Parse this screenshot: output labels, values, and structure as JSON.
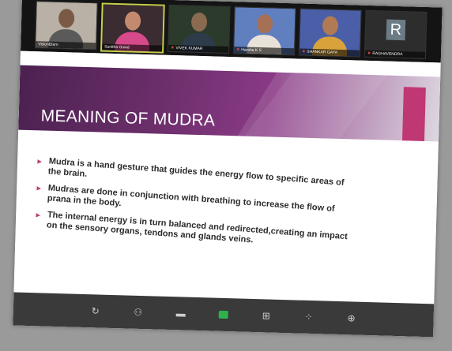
{
  "participants": [
    {
      "name": "VisionEtern",
      "type": "video",
      "skin": "#7a5a45",
      "shirt": "#5a5a5a",
      "bg": "#b9b0a6"
    },
    {
      "name": "Sunitha Gowd",
      "type": "video",
      "skin": "#c48a6f",
      "shirt": "#d6498a",
      "bg": "#3a2c30",
      "speaking": true
    },
    {
      "name": "VIVEK KUMAR",
      "type": "video",
      "skin": "#8a6a50",
      "shirt": "#2e3b4a",
      "bg": "#2b3a2a",
      "muted": true
    },
    {
      "name": "Harsha K S",
      "type": "video",
      "skin": "#a57055",
      "shirt": "#e8e2d8",
      "bg": "#5f7fbf",
      "muted": true
    },
    {
      "name": "SHANKAR GAYA",
      "type": "video",
      "skin": "#b07a55",
      "shirt": "#d9a23b",
      "bg": "#4a5fa8",
      "muted": true
    },
    {
      "name": "RAGHAVENDRA",
      "type": "avatar",
      "initial": "R",
      "muted": true
    }
  ],
  "slide": {
    "title": "MEANING OF MUDRA",
    "bullets": [
      "Mudra is a hand gesture that guides the energy flow to specific areas of the brain.",
      "Mudras are done in conjunction with breathing to increase the flow of prana in the body.",
      "The internal energy is in turn balanced and redirected,creating an impact on the sensory organs, tendons and glands veins."
    ]
  },
  "colors": {
    "title_band": "#6d2f6c",
    "accent": "#c03873",
    "share_button": "#2fb14b"
  },
  "controls": [
    {
      "name": "refresh-icon",
      "glyph": "↻"
    },
    {
      "name": "participants-icon",
      "glyph": "👥"
    },
    {
      "name": "chat-icon",
      "glyph": "▬"
    },
    {
      "name": "share-screen-icon",
      "glyph": ""
    },
    {
      "name": "view-icon",
      "glyph": "⊞"
    },
    {
      "name": "apps-icon",
      "glyph": "⁘"
    },
    {
      "name": "more-icon",
      "glyph": "⊕"
    }
  ]
}
